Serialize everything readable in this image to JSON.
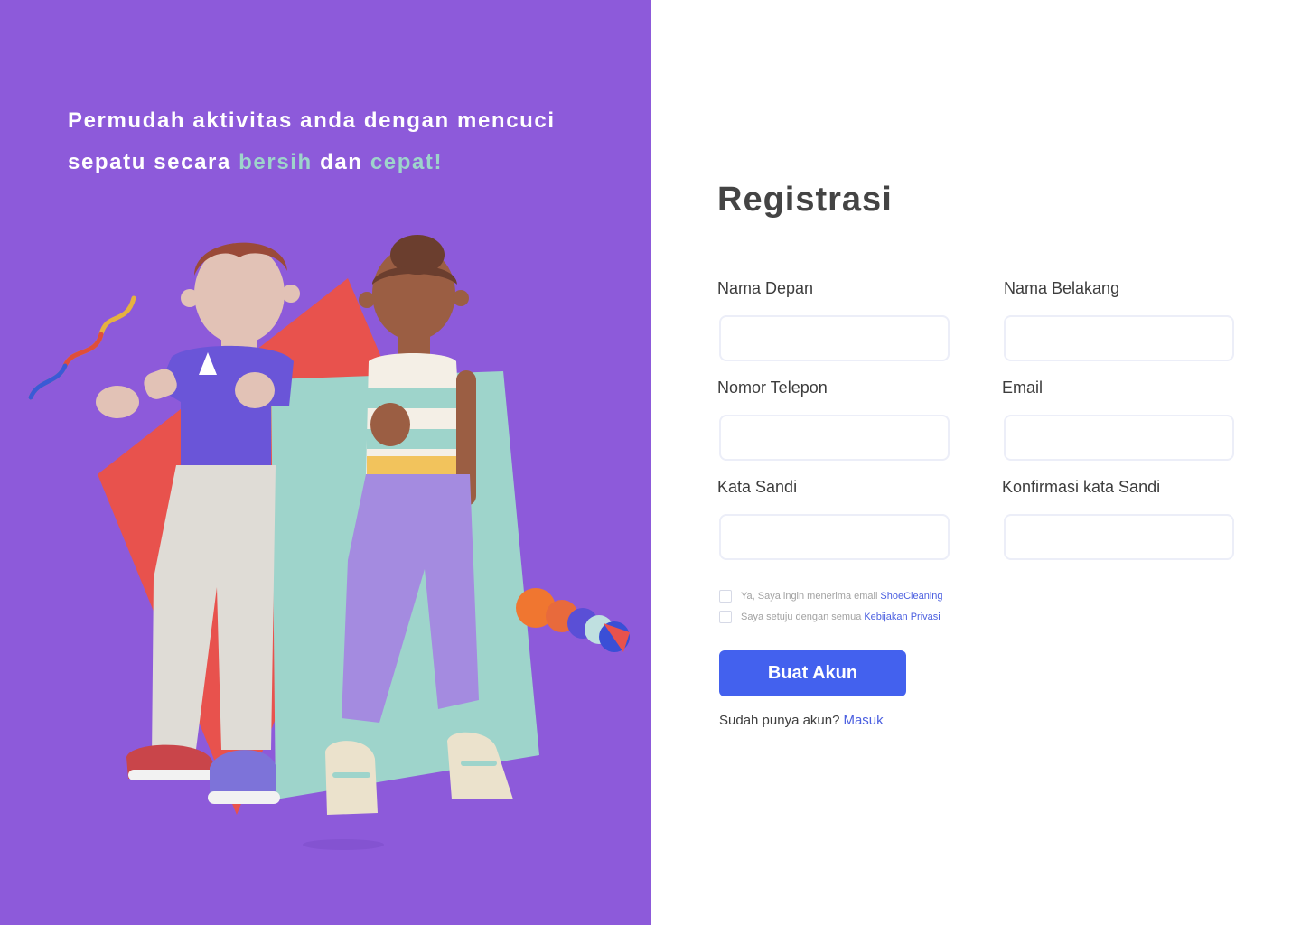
{
  "hero": {
    "line1": "Permudah aktivitas anda dengan mencuci",
    "line2_prefix": "sepatu secara ",
    "highlight1": "bersih",
    "connector": " dan ",
    "highlight2": "cepat!"
  },
  "form": {
    "title": "Registrasi",
    "first_name_label": "Nama Depan",
    "last_name_label": "Nama Belakang",
    "phone_label": "Nomor Telepon",
    "email_label": "Email",
    "password_label": "Kata Sandi",
    "confirm_password_label": "Konfirmasi kata Sandi",
    "first_name_value": "",
    "last_name_value": "",
    "phone_value": "",
    "email_value": "",
    "password_value": "",
    "confirm_password_value": ""
  },
  "checks": {
    "newsletter_text": "Ya, Saya ingin menerima email",
    "newsletter_link": "ShoeCleaning",
    "privacy_text": "Saya setuju dengan semua",
    "privacy_link": "Kebijakan Privasi"
  },
  "cta": {
    "label": "Buat Akun"
  },
  "login": {
    "prompt": "Sudah punya akun?",
    "link": "Masuk"
  },
  "colors": {
    "left_bg": "#8d5ada",
    "highlight": "#9ed4cb",
    "primary": "#4361ee",
    "link": "#4b5fe0",
    "shape_red": "#e8524d",
    "shape_teal": "#9ed4cb"
  }
}
